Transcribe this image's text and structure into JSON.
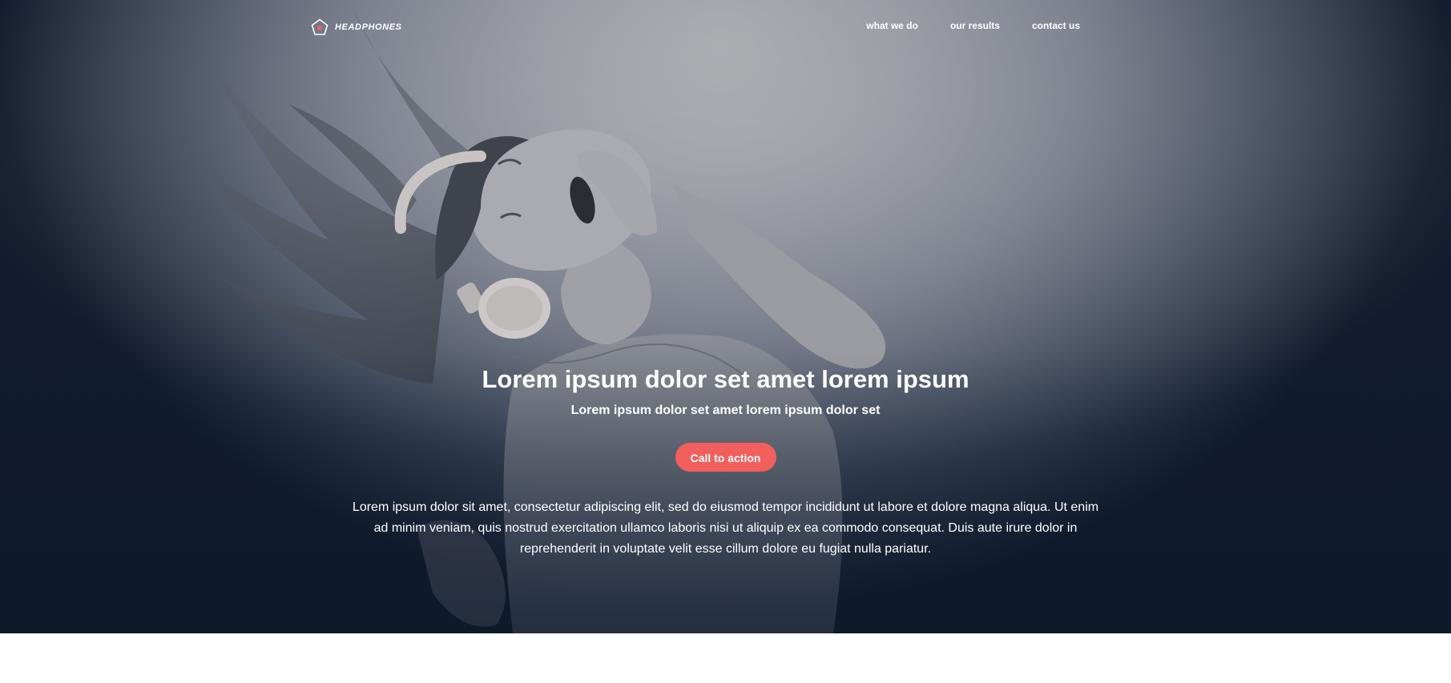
{
  "brand": {
    "logo_text": "HEADPHONES",
    "logo_icon": "pentagon-logo-icon"
  },
  "nav": {
    "links": [
      "what we do",
      "our results",
      "contact us"
    ]
  },
  "hero": {
    "headline": "Lorem ipsum dolor set amet lorem ipsum",
    "subheadline": "Lorem ipsum dolor set amet lorem ipsum dolor set",
    "cta_label": "Call to action",
    "body": "Lorem ipsum dolor sit amet, consectetur adipiscing elit, sed do eiusmod tempor incididunt ut labore et dolore magna aliqua. Ut enim ad minim veniam, quis nostrud exercitation ullamco laboris nisi ut aliquip ex ea commodo consequat. Duis aute irure dolor in reprehenderit in voluptate velit esse cillum dolore eu fugiat nulla pariatur."
  },
  "colors": {
    "accent": "#f25f5c",
    "text": "#ffffff",
    "overlay_dark": "#0f1a2e"
  }
}
